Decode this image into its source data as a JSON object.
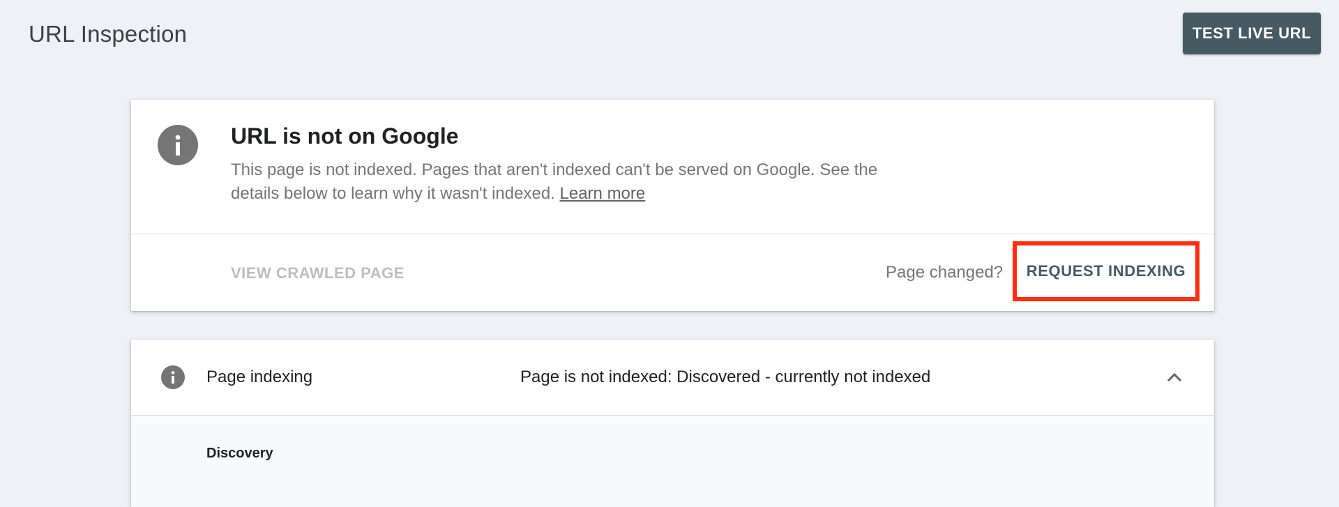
{
  "header": {
    "title": "URL Inspection",
    "test_live_label": "TEST LIVE URL"
  },
  "status_card": {
    "icon": "info-icon",
    "title": "URL is not on Google",
    "description": "This page is not indexed. Pages that aren't indexed can't be served on Google. See the details below to learn why it wasn't indexed.",
    "learn_more": "Learn more",
    "view_crawled_label": "VIEW CRAWLED PAGE",
    "page_changed": "Page changed?",
    "request_indexing_label": "REQUEST INDEXING",
    "highlight_color": "#ff2d10"
  },
  "indexing_card": {
    "icon": "info-icon",
    "label": "Page indexing",
    "status": "Page is not indexed: Discovered - currently not indexed",
    "collapse_icon": "chevron-up-icon",
    "section_title": "Discovery"
  },
  "colors": {
    "background": "#eef1f6",
    "primary_button": "#455a64",
    "icon_gray": "#757575"
  }
}
